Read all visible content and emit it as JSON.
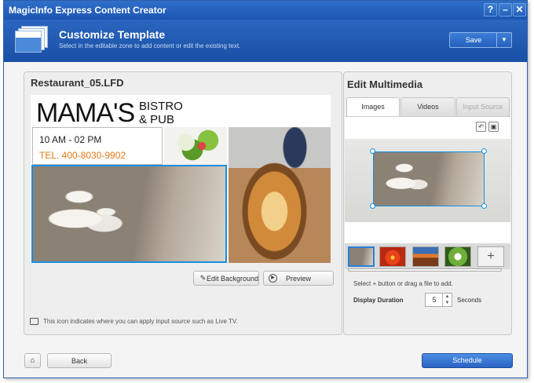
{
  "window": {
    "title": "MagicInfo Express Content Creator",
    "help": "?",
    "minimize": "–",
    "close": "✕"
  },
  "header": {
    "title": "Customize Template",
    "subtitle": "Select in the editable zone to add content or edit the existing text.",
    "save_label": "Save",
    "save_dropdown": "▼"
  },
  "template": {
    "file_name": "Restaurant_05.LFD",
    "name_text": "MAMA'S",
    "bistro_line1": "BISTRO",
    "bistro_line2": "& PUB",
    "hours": "10 AM - 02 PM",
    "tel": "TEL. 400-8030-9902"
  },
  "left_actions": {
    "edit_background": "Edit Background",
    "preview": "Preview"
  },
  "tv_note": "This icon indicates where you can apply input source such as Live TV.",
  "multimedia": {
    "title": "Edit Multimedia",
    "tabs": [
      {
        "label": "Images",
        "state": "active"
      },
      {
        "label": "Videos",
        "state": "normal"
      },
      {
        "label": "Input Source",
        "state": "disabled"
      }
    ],
    "add_thumb": "+",
    "add_hint": "Select + button or drag a file to add.",
    "duration_label": "Display Duration",
    "duration_value": "5",
    "duration_unit": "Seconds",
    "thumbnails": [
      "chefs-photo",
      "red-flower-photo",
      "canyon-photo",
      "white-flower-photo"
    ]
  },
  "footer": {
    "back": "Back",
    "schedule": "Schedule"
  },
  "colors": {
    "titlebar": "#1d56b2",
    "accent_selection": "#1a8fe0",
    "tel_orange": "#e07a18",
    "schedule_button": "#2a63c4"
  }
}
